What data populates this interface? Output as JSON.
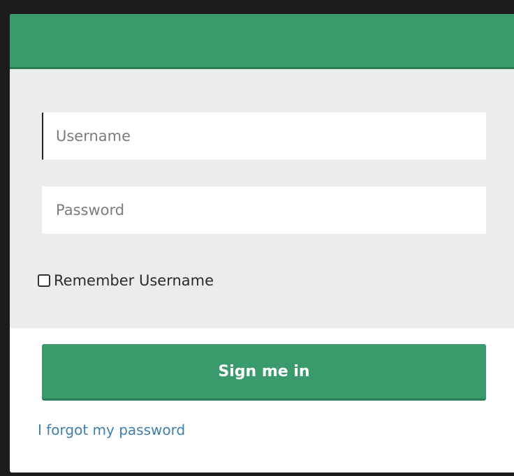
{
  "login": {
    "username_placeholder": "Username",
    "password_placeholder": "Password",
    "remember_label": "Remember Username",
    "remember_checked": false,
    "signin_label": "Sign me in",
    "forgot_label": "I forgot my password"
  },
  "colors": {
    "header": "#3a9a6c",
    "button": "#3a9a6c",
    "body": "#ebecee",
    "link": "#3e7fb0"
  }
}
